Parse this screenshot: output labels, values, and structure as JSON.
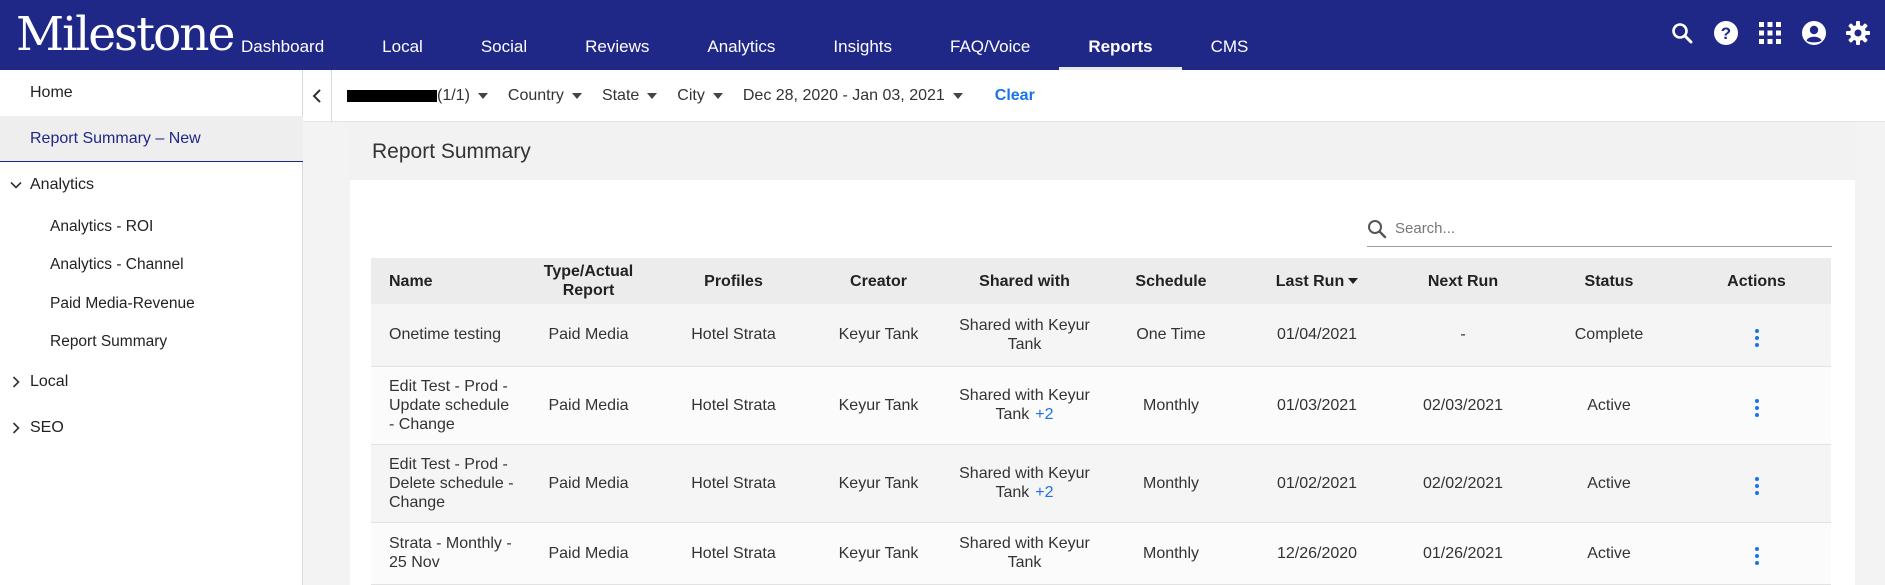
{
  "app": {
    "logo_text": "Milestone"
  },
  "nav": {
    "items": [
      "Dashboard",
      "Local",
      "Social",
      "Reviews",
      "Analytics",
      "Insights",
      "FAQ/Voice",
      "Reports",
      "CMS"
    ],
    "active": "Reports"
  },
  "top_icons": [
    "search-icon",
    "help-icon",
    "apps-grid-icon",
    "account-icon",
    "settings-icon"
  ],
  "sidebar": {
    "home": "Home",
    "report_summary_new": "Report Summary – New",
    "analytics": {
      "label": "Analytics",
      "expanded": true,
      "children": [
        "Analytics - ROI",
        "Analytics - Channel",
        "Paid Media-Revenue",
        "Report Summary"
      ]
    },
    "local": {
      "label": "Local",
      "expanded": false
    },
    "seo": {
      "label": "SEO",
      "expanded": false
    }
  },
  "filters": {
    "account_suffix": "(1/1)",
    "country": "Country",
    "state": "State",
    "city": "City",
    "date_range": "Dec 28, 2020 - Jan 03, 2021",
    "clear": "Clear"
  },
  "panel": {
    "title": "Report Summary",
    "search_placeholder": "Search..."
  },
  "table": {
    "headers": {
      "name": "Name",
      "type_line1": "Type/Actual",
      "type_line2": "Report",
      "profiles": "Profiles",
      "creator": "Creator",
      "shared_with": "Shared with",
      "schedule": "Schedule",
      "last_run": "Last Run",
      "next_run": "Next Run",
      "status": "Status",
      "actions": "Actions"
    },
    "rows": [
      {
        "name": "Onetime testing",
        "type": "Paid Media",
        "profiles": "Hotel Strata",
        "creator": "Keyur Tank",
        "shared": "Shared with Keyur Tank",
        "shared_extra": "",
        "schedule": "One Time",
        "last_run": "01/04/2021",
        "next_run": "-",
        "status": "Complete"
      },
      {
        "name": "Edit Test - Prod - Update schedule - Change",
        "type": "Paid Media",
        "profiles": "Hotel Strata",
        "creator": "Keyur Tank",
        "shared": "Shared with Keyur Tank",
        "shared_extra": "+2",
        "schedule": "Monthly",
        "last_run": "01/03/2021",
        "next_run": "02/03/2021",
        "status": "Active"
      },
      {
        "name": "Edit Test - Prod - Delete schedule - Change",
        "type": "Paid Media",
        "profiles": "Hotel Strata",
        "creator": "Keyur Tank",
        "shared": "Shared with Keyur Tank",
        "shared_extra": "+2",
        "schedule": "Monthly",
        "last_run": "01/02/2021",
        "next_run": "02/02/2021",
        "status": "Active"
      },
      {
        "name": "Strata - Monthly - 25 Nov",
        "type": "Paid Media",
        "profiles": "Hotel Strata",
        "creator": "Keyur Tank",
        "shared": "Shared with Keyur Tank",
        "shared_extra": "",
        "schedule": "Monthly",
        "last_run": "12/26/2020",
        "next_run": "01/26/2021",
        "status": "Active"
      }
    ]
  },
  "colors": {
    "nav_bg": "#1f2787",
    "accent": "#1a73e8"
  }
}
